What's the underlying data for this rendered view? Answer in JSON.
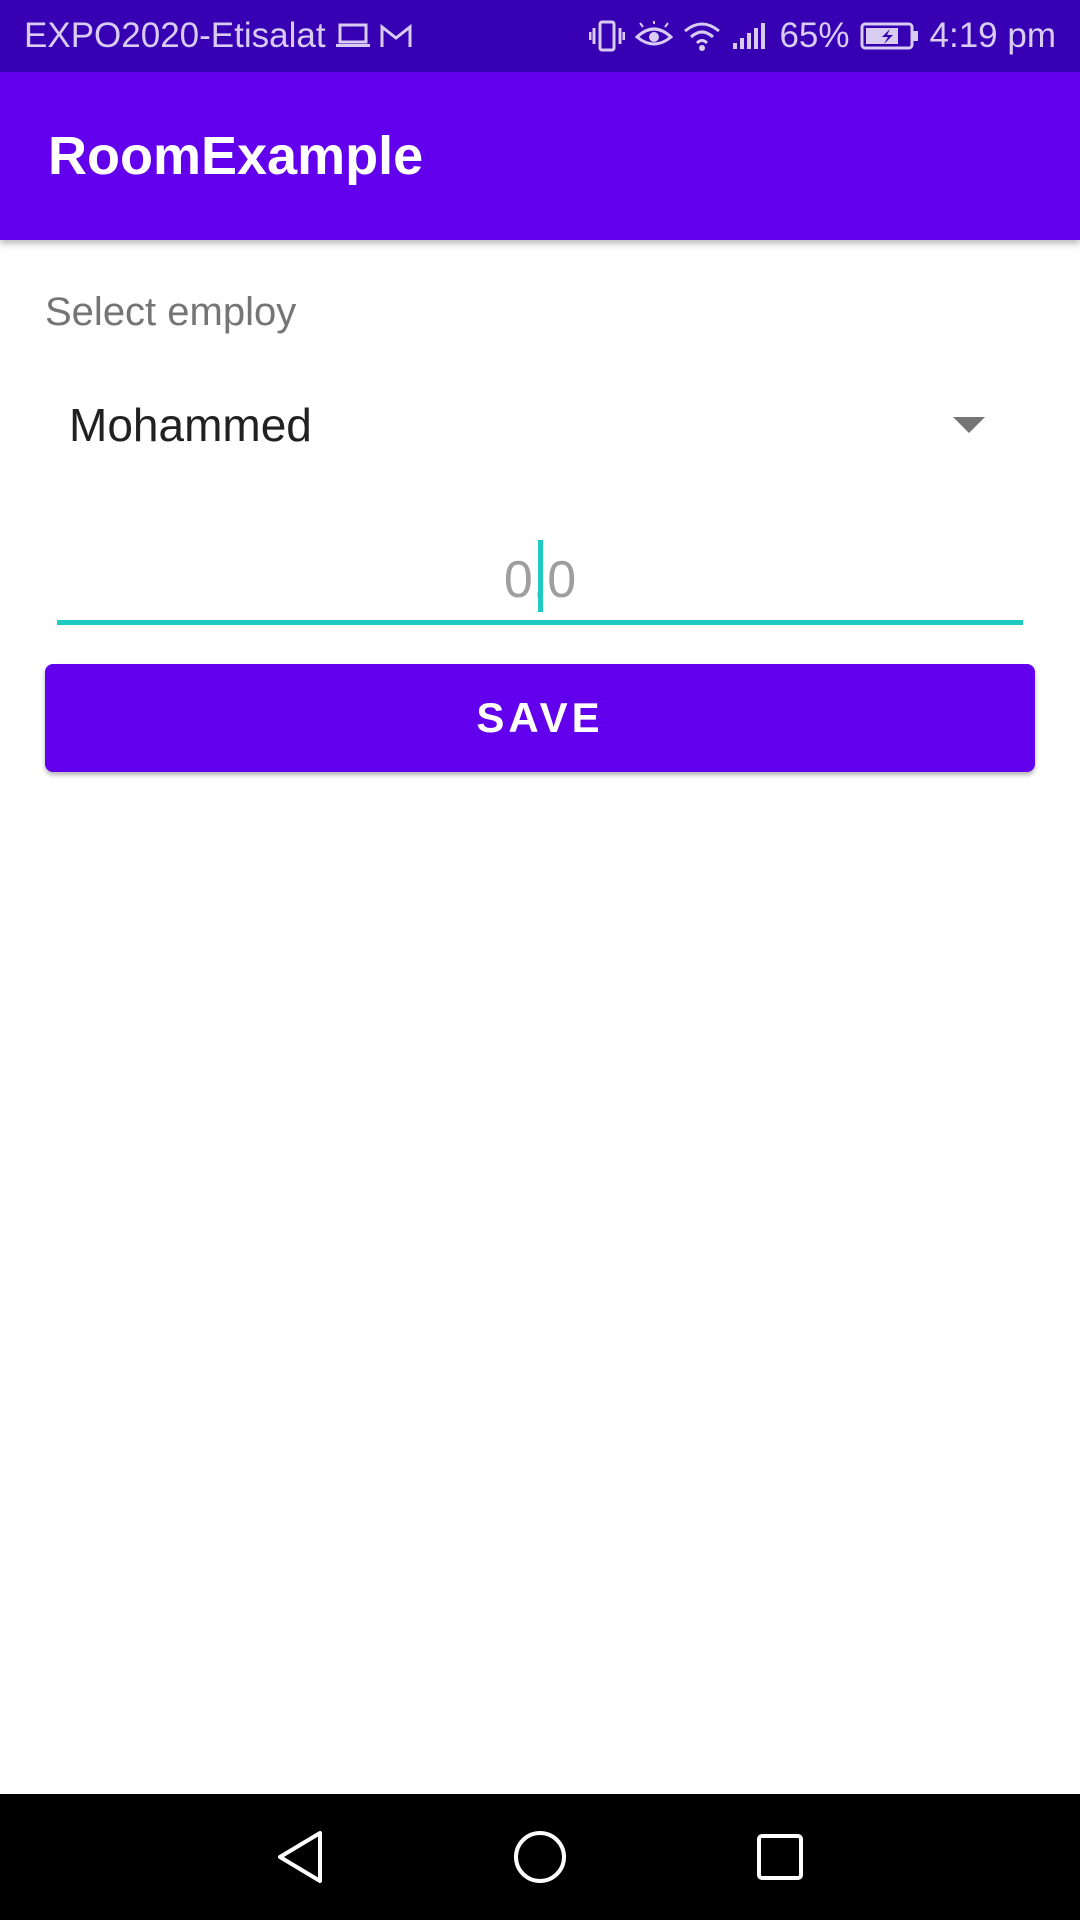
{
  "status_bar": {
    "carrier": "EXPO2020-Etisalat",
    "battery_percent": "65%",
    "time": "4:19 pm",
    "icons": [
      "laptop-icon",
      "gmail-icon",
      "vibrate-icon",
      "eye-icon",
      "wifi-icon",
      "signal-icon",
      "battery-charging-icon"
    ]
  },
  "app_bar": {
    "title": "RoomExample"
  },
  "form": {
    "employee_label": "Select employ",
    "employee_selected": "Mohammed",
    "amount_value": "0.0"
  },
  "buttons": {
    "save_label": "SAVE"
  },
  "nav_bar": {
    "icons": [
      "back-icon",
      "home-icon",
      "recents-icon"
    ]
  },
  "colors": {
    "status_bar": "#3700B3",
    "primary": "#6200EE",
    "accent": "#1ECBC1"
  }
}
